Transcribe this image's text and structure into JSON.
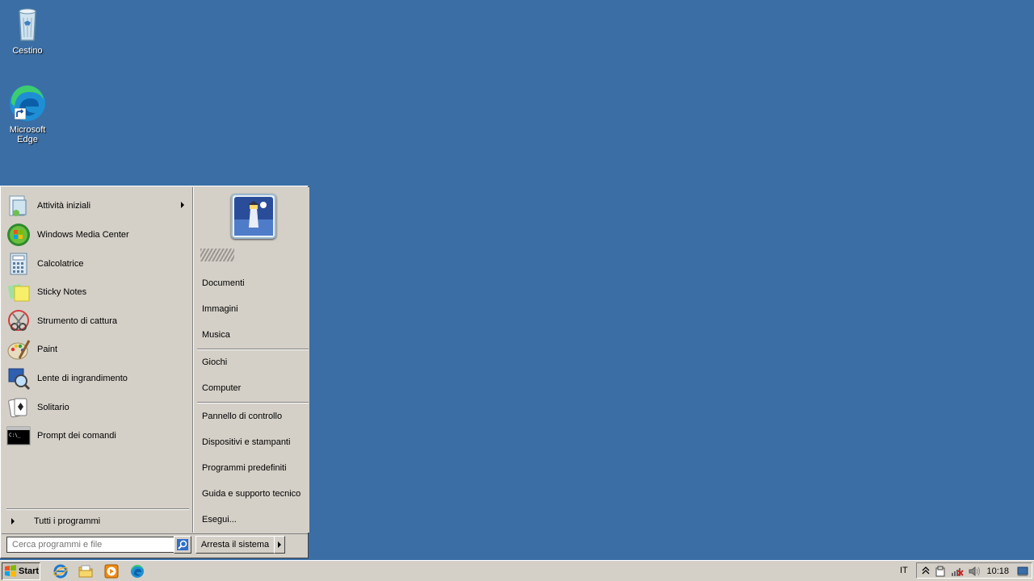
{
  "desktop": {
    "icons": [
      {
        "label": "Cestino"
      },
      {
        "label": "Microsoft Edge"
      }
    ]
  },
  "start_menu": {
    "programs": [
      {
        "label": "Attività iniziali",
        "has_submenu": true
      },
      {
        "label": "Windows Media Center"
      },
      {
        "label": "Calcolatrice"
      },
      {
        "label": "Sticky Notes"
      },
      {
        "label": "Strumento di cattura"
      },
      {
        "label": "Paint"
      },
      {
        "label": "Lente di ingrandimento"
      },
      {
        "label": "Solitario"
      },
      {
        "label": "Prompt dei comandi"
      }
    ],
    "all_programs": "Tutti i programmi",
    "search_placeholder": "Cerca programmi e file",
    "right_items": [
      "Documenti",
      "Immagini",
      "Musica",
      "Giochi",
      "Computer",
      "Pannello di controllo",
      "Dispositivi e stampanti",
      "Programmi predefiniti",
      "Guida e supporto tecnico",
      "Esegui..."
    ],
    "shutdown_label": "Arresta il sistema"
  },
  "taskbar": {
    "start_label": "Start",
    "language": "IT",
    "clock": "10:18"
  },
  "colors": {
    "desktop": "#3a6ea5",
    "menu_bg": "#d4d0c8"
  }
}
